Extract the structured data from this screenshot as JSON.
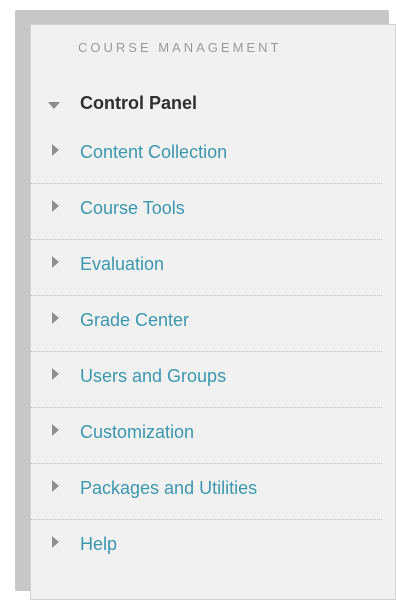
{
  "panel": {
    "section_title": "COURSE MANAGEMENT",
    "control_panel_label": "Control Panel",
    "items": [
      {
        "label": "Content Collection"
      },
      {
        "label": "Course Tools"
      },
      {
        "label": "Evaluation"
      },
      {
        "label": "Grade Center"
      },
      {
        "label": "Users and Groups"
      },
      {
        "label": "Customization"
      },
      {
        "label": "Packages and Utilities"
      },
      {
        "label": "Help"
      }
    ]
  },
  "colors": {
    "link": "#3a97b0",
    "heading": "#2f2f2f",
    "muted": "#9a9a9a",
    "panel_background": "#f1f1f1",
    "frame": "#c7c7c7"
  },
  "icons": {
    "expanded": "triangle-down-icon",
    "collapsed": "triangle-right-icon"
  }
}
